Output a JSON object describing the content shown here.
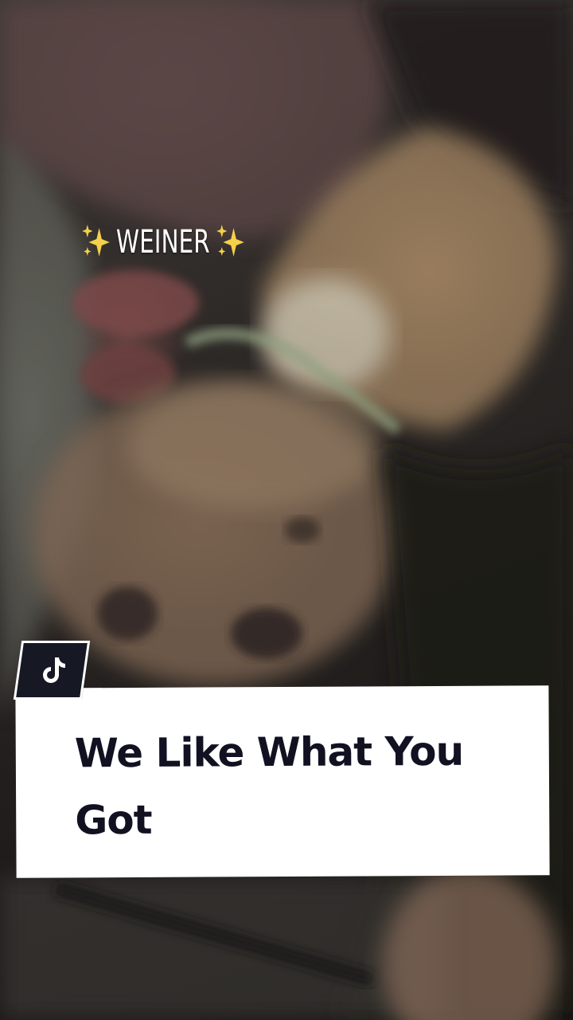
{
  "sticker": {
    "text": "WEINER",
    "left_icon": "sparkles-icon",
    "right_icon": "sparkles-icon",
    "sparkle_color": "#f5d04a"
  },
  "caption": {
    "line1": "We Like What You",
    "line2": "Got",
    "text_color": "#111122",
    "card_color": "#ffffff"
  },
  "badge": {
    "icon": "tiktok-logo-icon",
    "background": "#161823"
  }
}
